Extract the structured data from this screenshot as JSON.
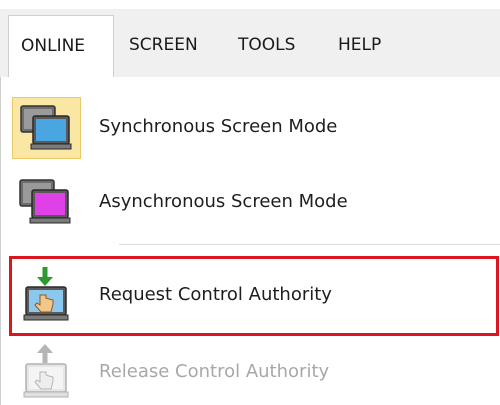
{
  "menubar": {
    "items": [
      {
        "label": "ONLINE",
        "active": true
      },
      {
        "label": "SCREEN",
        "active": false
      },
      {
        "label": "TOOLS",
        "active": false
      },
      {
        "label": "HELP",
        "active": false
      }
    ]
  },
  "dropdown": {
    "items": [
      {
        "label": "Synchronous Screen Mode",
        "icon": "synchronous-screen-icon",
        "checked": true,
        "enabled": true
      },
      {
        "label": "Asynchronous Screen Mode",
        "icon": "asynchronous-screen-icon",
        "checked": false,
        "enabled": true
      },
      {
        "label": "Request Control Authority",
        "icon": "request-control-icon",
        "checked": false,
        "enabled": true,
        "highlighted": true
      },
      {
        "label": "Release Control Authority",
        "icon": "release-control-icon",
        "checked": false,
        "enabled": false
      }
    ]
  },
  "colors": {
    "menubar_bg": "#f0f0f0",
    "checked_bg": "#fbe7a4",
    "highlight_border": "#d9161e",
    "disabled_text": "#a8a8a8",
    "async_screen": "#e040e8",
    "sync_screen": "#4aa6e0"
  }
}
